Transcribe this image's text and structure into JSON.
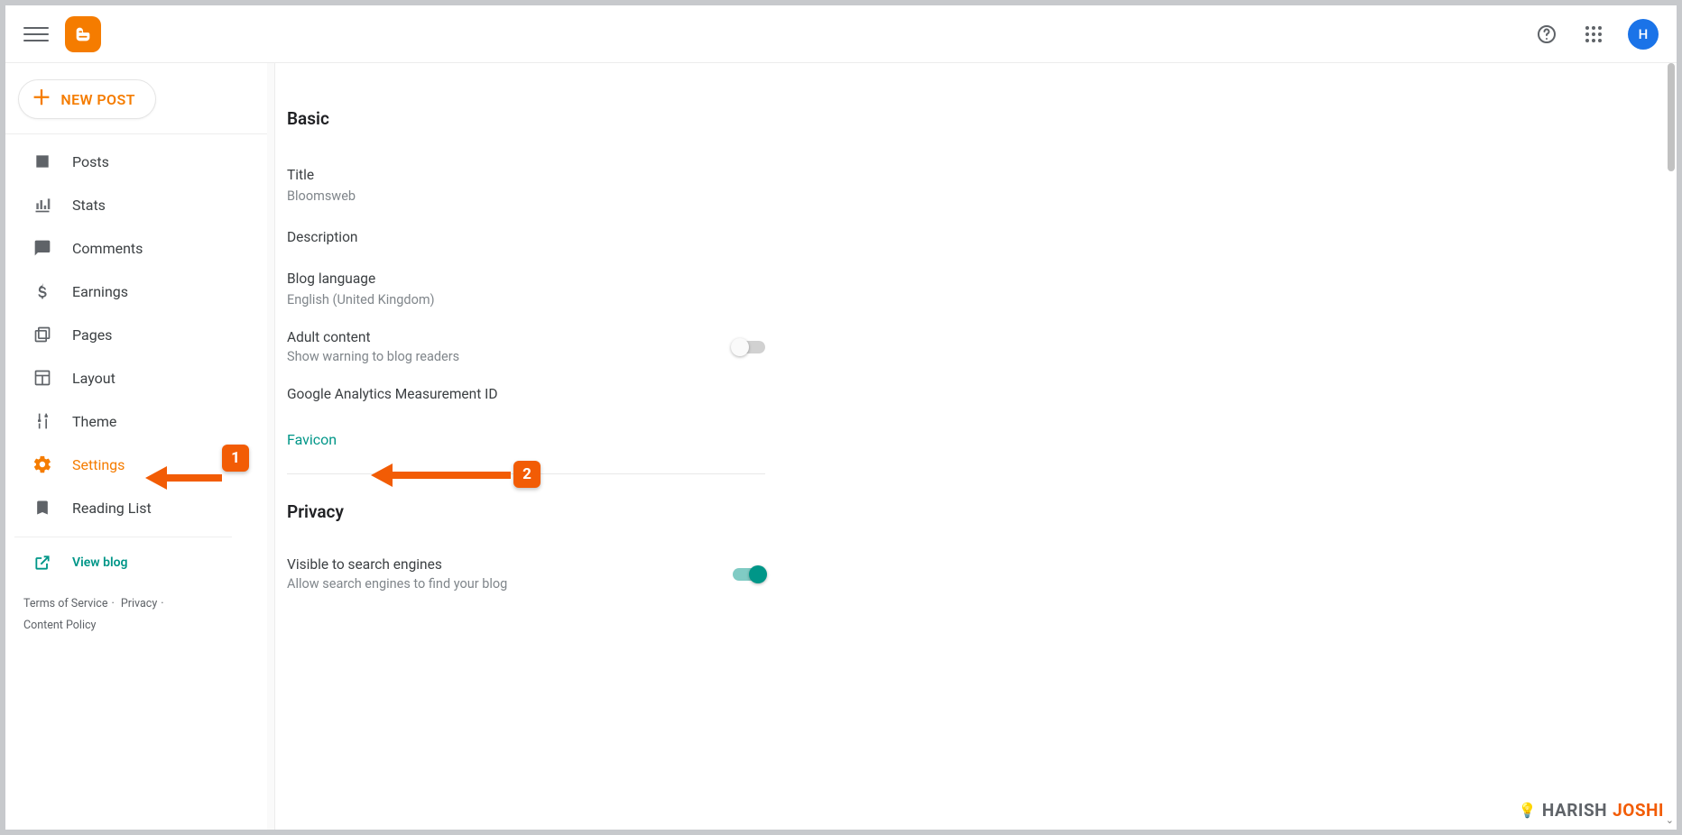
{
  "topbar": {
    "avatar_initial": "H"
  },
  "newpost_label": "NEW POST",
  "sidebar": {
    "items": [
      {
        "label": "Posts"
      },
      {
        "label": "Stats"
      },
      {
        "label": "Comments"
      },
      {
        "label": "Earnings"
      },
      {
        "label": "Pages"
      },
      {
        "label": "Layout"
      },
      {
        "label": "Theme"
      },
      {
        "label": "Settings"
      },
      {
        "label": "Reading List"
      }
    ],
    "view_blog": "View blog",
    "footer": {
      "terms": "Terms of Service",
      "privacy": "Privacy",
      "content_policy": "Content Policy"
    }
  },
  "settings": {
    "basic": {
      "heading": "Basic",
      "title_label": "Title",
      "title_value": "Bloomsweb",
      "description_label": "Description",
      "language_label": "Blog language",
      "language_value": "English (United Kingdom)",
      "adult_label": "Adult content",
      "adult_sub": "Show warning to blog readers",
      "ga_label": "Google Analytics Measurement ID",
      "favicon_label": "Favicon"
    },
    "privacy": {
      "heading": "Privacy",
      "visible_label": "Visible to search engines",
      "visible_sub": "Allow search engines to find your blog"
    }
  },
  "annotations": {
    "badge1": "1",
    "badge2": "2"
  },
  "watermark": {
    "first": "HARISH",
    "second": "JOSHI"
  }
}
